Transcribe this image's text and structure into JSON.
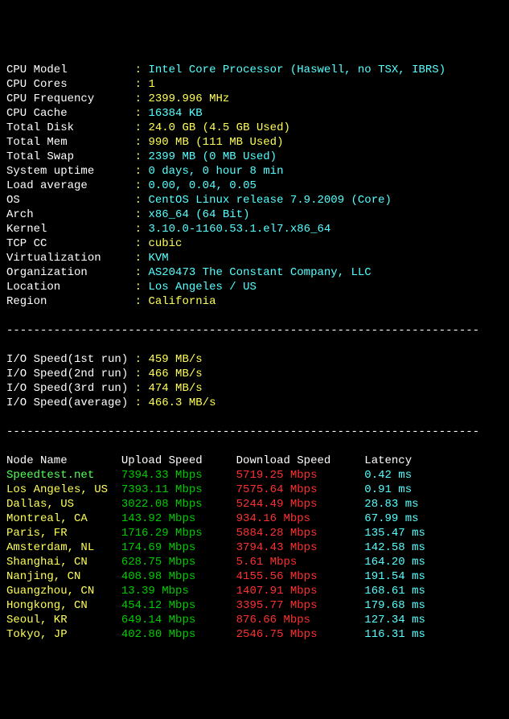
{
  "dashes": "----------------------------------------------------------------------",
  "sys": [
    {
      "label": "CPU Model          ",
      "value": "Intel Core Processor (Haswell, no TSX, IBRS)",
      "cls": "cyan"
    },
    {
      "label": "CPU Cores          ",
      "value": "1",
      "cls": "yel"
    },
    {
      "label": "CPU Frequency      ",
      "value": "2399.996 MHz",
      "cls": "yel"
    },
    {
      "label": "CPU Cache          ",
      "value": "16384 KB",
      "cls": "cyan"
    },
    {
      "label": "Total Disk         ",
      "value": "24.0 GB (4.5 GB Used)",
      "cls": "yel"
    },
    {
      "label": "Total Mem          ",
      "value": "990 MB (111 MB Used)",
      "cls": "yel"
    },
    {
      "label": "Total Swap         ",
      "value": "2399 MB (0 MB Used)",
      "cls": "cyan"
    },
    {
      "label": "System uptime      ",
      "value": "0 days, 0 hour 8 min",
      "cls": "cyan"
    },
    {
      "label": "Load average       ",
      "value": "0.00, 0.04, 0.05",
      "cls": "cyan"
    },
    {
      "label": "OS                 ",
      "value": "CentOS Linux release 7.9.2009 (Core)",
      "cls": "cyan"
    },
    {
      "label": "Arch               ",
      "value": "x86_64 (64 Bit)",
      "cls": "cyan"
    },
    {
      "label": "Kernel             ",
      "value": "3.10.0-1160.53.1.el7.x86_64",
      "cls": "cyan"
    },
    {
      "label": "TCP CC             ",
      "value": "cubic",
      "cls": "yel"
    },
    {
      "label": "Virtualization     ",
      "value": "KVM",
      "cls": "cyan"
    },
    {
      "label": "Organization       ",
      "value": "AS20473 The Constant Company, LLC",
      "cls": "cyan"
    },
    {
      "label": "Location           ",
      "value": "Los Angeles / US",
      "cls": "cyan"
    },
    {
      "label": "Region             ",
      "value": "California",
      "cls": "yel"
    }
  ],
  "io": [
    {
      "label": "I/O Speed(1st run) ",
      "value": "459 MB/s"
    },
    {
      "label": "I/O Speed(2nd run) ",
      "value": "466 MB/s"
    },
    {
      "label": "I/O Speed(3rd run) ",
      "value": "474 MB/s"
    },
    {
      "label": "I/O Speed(average) ",
      "value": "466.3 MB/s"
    }
  ],
  "speed_header": {
    "node": "Node Name        ",
    "up": "Upload Speed     ",
    "down": "Download Speed     ",
    "lat": "Latency"
  },
  "speed": [
    {
      "node": "Speedtest.net    ",
      "up": "7394.33 Mbps     ",
      "down": "5719.25 Mbps       ",
      "lat": "0.42 ms",
      "ncls": "grnb"
    },
    {
      "node": "Los Angeles, US  ",
      "up": "7393.11 Mbps     ",
      "down": "7575.64 Mbps       ",
      "lat": "0.91 ms",
      "ncls": "yel"
    },
    {
      "node": "Dallas, US       ",
      "up": "3022.08 Mbps     ",
      "down": "5244.49 Mbps       ",
      "lat": "28.83 ms",
      "ncls": "yel"
    },
    {
      "node": "Montreal, CA     ",
      "up": "143.92 Mbps      ",
      "down": "934.16 Mbps        ",
      "lat": "67.99 ms",
      "ncls": "yel"
    },
    {
      "node": "Paris, FR        ",
      "up": "1716.29 Mbps     ",
      "down": "5884.28 Mbps       ",
      "lat": "135.47 ms",
      "ncls": "yel"
    },
    {
      "node": "Amsterdam, NL    ",
      "up": "174.69 Mbps      ",
      "down": "3794.43 Mbps       ",
      "lat": "142.58 ms",
      "ncls": "yel"
    },
    {
      "node": "Shanghai, CN     ",
      "up": "628.75 Mbps      ",
      "down": "5.61 Mbps          ",
      "lat": "164.20 ms",
      "ncls": "yel"
    },
    {
      "node": "Nanjing, CN      ",
      "up": "408.98 Mbps      ",
      "down": "4155.56 Mbps       ",
      "lat": "191.54 ms",
      "ncls": "yel"
    },
    {
      "node": "Guangzhou, CN    ",
      "up": "13.39 Mbps       ",
      "down": "1407.91 Mbps       ",
      "lat": "168.61 ms",
      "ncls": "yel"
    },
    {
      "node": "Hongkong, CN     ",
      "up": "454.12 Mbps      ",
      "down": "3395.77 Mbps       ",
      "lat": "179.68 ms",
      "ncls": "yel"
    },
    {
      "node": "Seoul, KR        ",
      "up": "649.14 Mbps      ",
      "down": "876.66 Mbps        ",
      "lat": "127.34 ms",
      "ncls": "yel"
    },
    {
      "node": "Tokyo, JP        ",
      "up": "402.80 Mbps      ",
      "down": "2546.75 Mbps       ",
      "lat": "116.31 ms",
      "ncls": "yel"
    }
  ]
}
